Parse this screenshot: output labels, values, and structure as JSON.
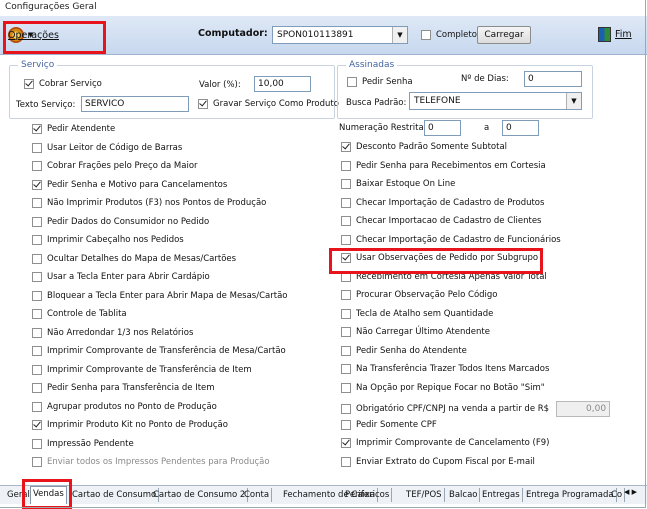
{
  "window": {
    "title": "Configurações Geral"
  },
  "toolbar": {
    "operations_label": "Operações",
    "computer_label": "Computador:",
    "computer_value": "SPON010113891",
    "complete_label": "Completo",
    "load_button": "Carregar",
    "exit_label": "Fim"
  },
  "service": {
    "legend": "Serviço",
    "charge_label": "Cobrar Serviço",
    "value_label": "Valor (%):",
    "value": "10,00",
    "text_label": "Texto Serviço:",
    "text_value": "SERVICO",
    "save_product_label": "Gravar Serviço Como Produto"
  },
  "signed": {
    "legend": "Assinadas",
    "ask_password_label": "Pedir Senha",
    "days_label": "Nº de Dias:",
    "days_value": "0",
    "default_search_label": "Busca Padrão:",
    "default_search_value": "TELEFONE"
  },
  "restricted": {
    "label": "Numeração Restrita:",
    "from": "0",
    "to_label": "a",
    "to": "0"
  },
  "left_options": [
    {
      "label": "Pedir Atendente",
      "checked": true
    },
    {
      "label": "Usar Leitor de Código de Barras",
      "checked": false
    },
    {
      "label": "Cobrar Frações pelo Preço da Maior",
      "checked": false
    },
    {
      "label": "Pedir Senha e Motivo para Cancelamentos",
      "checked": true
    },
    {
      "label": "Não Imprimir Produtos (F3) nos Pontos de Produção",
      "checked": false
    },
    {
      "label": "Pedir Dados do Consumidor no Pedido",
      "checked": false
    },
    {
      "label": "Imprimir Cabeçalho nos Pedidos",
      "checked": false
    },
    {
      "label": "Ocultar Detalhes do Mapa de Mesas/Cartões",
      "checked": false
    },
    {
      "label": "Usar a Tecla Enter para Abrir Cardápio",
      "checked": false
    },
    {
      "label": "Bloquear a Tecla Enter para Abrir Mapa de Mesas/Cartão",
      "checked": false
    },
    {
      "label": "Controle de Tablita",
      "checked": false
    },
    {
      "label": "Não Arredondar 1/3 nos Relatórios",
      "checked": false
    },
    {
      "label": "Imprimir Comprovante de Transferência de Mesa/Cartão",
      "checked": false
    },
    {
      "label": "Imprimir Comprovante de Transferência de Item",
      "checked": false
    },
    {
      "label": "Pedir Senha para Transferência de Item",
      "checked": false
    },
    {
      "label": "Agrupar produtos no Ponto de Produção",
      "checked": false
    },
    {
      "label": "Imprimir Produto Kit no Ponto de Produção",
      "checked": true
    },
    {
      "label": "Impressão Pendente",
      "checked": false
    },
    {
      "label": "Enviar todos os Impressos Pendentes para Produção",
      "checked": false,
      "disabled": true
    }
  ],
  "right_options": [
    {
      "label": "Desconto Padrão Somente Subtotal",
      "checked": true
    },
    {
      "label": "Pedir Senha para Recebimentos em Cortesia",
      "checked": false
    },
    {
      "label": "Baixar Estoque On Line",
      "checked": false
    },
    {
      "label": "Checar Importação de Cadastro de Produtos",
      "checked": false
    },
    {
      "label": "Checar Importacao de Cadastro de Clientes",
      "checked": false
    },
    {
      "label": "Checar Importação de Cadastro de Funcionários",
      "checked": false
    },
    {
      "label": "Usar Observações de Pedido por Subgrupo",
      "checked": true
    },
    {
      "label": "Recebimento em Cortesia Apenas Valor Total",
      "checked": false
    },
    {
      "label": "Procurar Observação Pelo Código",
      "checked": false
    },
    {
      "label": "Tecla de Atalho sem Quantidade",
      "checked": false
    },
    {
      "label": "Não Carregar Último Atendente",
      "checked": false
    },
    {
      "label": "Pedir Senha do Atendente",
      "checked": false
    },
    {
      "label": "Na Transferência Trazer Todos Itens Marcados",
      "checked": false
    },
    {
      "label": "Na Opção por Repique Focar no Botão \"Sim\"",
      "checked": false
    },
    {
      "label": "Obrigatório CPF/CNPJ na venda a partir de R$",
      "checked": false,
      "value": "0,00"
    },
    {
      "label": "Pedir Somente CPF",
      "checked": false
    },
    {
      "label": "Imprimir Comprovante de Cancelamento (F9)",
      "checked": true
    },
    {
      "label": "Enviar Extrato do Cupom Fiscal por E-mail",
      "checked": false
    }
  ],
  "tabs": [
    "Geral",
    "Vendas",
    "Cartao de Consumo",
    "Cartao de Consumo 2",
    "Conta",
    "Fechamento de Caixa",
    "Perifericos",
    "TEF/POS",
    "Balcao",
    "Entregas",
    "Entrega Programada",
    "Co"
  ],
  "active_tab": "Vendas"
}
